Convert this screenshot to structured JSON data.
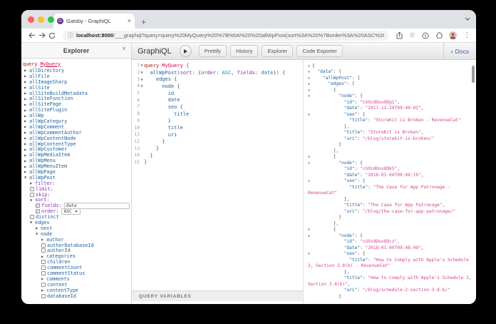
{
  "colors": {
    "traffic_red": "#ff5f57",
    "traffic_yellow": "#febc2e",
    "traffic_green": "#28c840",
    "field_blue": "#1f61a0",
    "arg_purple": "#8b2bb9",
    "keyword_red": "#b11a04",
    "def_pink": "#d2054e",
    "enum_cyan": "#0b7fc7",
    "string_pink": "#d64292",
    "docs_blue": "#3b5998"
  },
  "browser": {
    "tab_title": "Gatsby - GraphiQL",
    "tab_close": "×",
    "new_tab": "+",
    "favicon_letter": "G",
    "url_host": "localhost:8000",
    "url_path": "/___graphql?query=query%20MyQuery%20%7B%0A%20%20allWpPost(sort%3A%20%7Border%3A%20ASC%2C%20fields%3A%2...",
    "info_icon": "ⓘ",
    "star_icon": "☆",
    "menu_icon": "⋮"
  },
  "graphiql": {
    "logo": "GraphiQL",
    "buttons": [
      "Prettify",
      "History",
      "Explorer",
      "Code Exporter"
    ],
    "docs_chevron": "‹",
    "docs_label": "Docs",
    "variables_title": "QUERY VARIABLES"
  },
  "explorer": {
    "title": "Explorer",
    "close": "×",
    "query_keyword": "query",
    "query_name": "MyQuery",
    "items": [
      {
        "a": "r",
        "t": "allDirectory",
        "k": "f",
        "i": 0
      },
      {
        "a": "r",
        "t": "allFile",
        "k": "f",
        "i": 0
      },
      {
        "a": "r",
        "t": "allImageSharp",
        "k": "f",
        "i": 0
      },
      {
        "a": "r",
        "t": "allSite",
        "k": "f",
        "i": 0
      },
      {
        "a": "r",
        "t": "allSiteBuildMetadata",
        "k": "f",
        "i": 0
      },
      {
        "a": "r",
        "t": "allSiteFunction",
        "k": "f",
        "i": 0
      },
      {
        "a": "r",
        "t": "allSitePage",
        "k": "f",
        "i": 0
      },
      {
        "a": "r",
        "t": "allSitePlugin",
        "k": "f",
        "i": 0
      },
      {
        "a": "r",
        "t": "allWp",
        "k": "f",
        "i": 0
      },
      {
        "a": "r",
        "t": "allWpCategory",
        "k": "f",
        "i": 0
      },
      {
        "a": "r",
        "t": "allWpComment",
        "k": "f",
        "i": 0
      },
      {
        "a": "r",
        "t": "allWpCommentAuthor",
        "k": "f",
        "i": 0
      },
      {
        "a": "r",
        "t": "allWpContentNode",
        "k": "f",
        "i": 0
      },
      {
        "a": "r",
        "t": "allWpContentType",
        "k": "f",
        "i": 0
      },
      {
        "a": "r",
        "t": "allWpCustomer",
        "k": "f",
        "i": 0
      },
      {
        "a": "r",
        "t": "allWpMediaItem",
        "k": "f",
        "i": 0
      },
      {
        "a": "r",
        "t": "allWpMenu",
        "k": "f",
        "i": 0
      },
      {
        "a": "r",
        "t": "allWpMenuItem",
        "k": "f",
        "i": 0
      },
      {
        "a": "r",
        "t": "allWpPage",
        "k": "f",
        "i": 0
      },
      {
        "a": "d",
        "t": "allWpPost",
        "k": "f",
        "i": 0
      },
      {
        "a": "r",
        "t": "filter:",
        "k": "a",
        "i": 1
      },
      {
        "c": "u",
        "t": "limit:",
        "k": "a",
        "i": 1
      },
      {
        "c": "u",
        "t": "skip:",
        "k": "a",
        "i": 1
      },
      {
        "a": "d",
        "t": "sort:",
        "k": "a",
        "i": 1
      },
      {
        "c": "c",
        "t": "fields:",
        "k": "a",
        "i": 2,
        "ctl": {
          "type": "input",
          "value": "date"
        }
      },
      {
        "c": "c",
        "t": "order:",
        "k": "a",
        "i": 2,
        "ctl": {
          "type": "select",
          "value": "ASC"
        }
      },
      {
        "c": "u",
        "t": "distinct",
        "k": "f",
        "i": 1
      },
      {
        "a": "d",
        "t": "edges",
        "k": "f",
        "i": 1
      },
      {
        "a": "r",
        "t": "next",
        "k": "f",
        "i": 2
      },
      {
        "a": "d",
        "t": "node",
        "k": "f",
        "i": 2
      },
      {
        "a": "r",
        "t": "author",
        "k": "f",
        "i": 3
      },
      {
        "c": "u",
        "t": "authorDatabaseId",
        "k": "f",
        "i": 3
      },
      {
        "c": "u",
        "t": "authorId",
        "k": "f",
        "i": 3
      },
      {
        "a": "r",
        "t": "categories",
        "k": "f",
        "i": 3
      },
      {
        "c": "u",
        "t": "children",
        "k": "f",
        "i": 3
      },
      {
        "c": "u",
        "t": "commentCount",
        "k": "f",
        "i": 3
      },
      {
        "c": "u",
        "t": "commentStatus",
        "k": "f",
        "i": 3
      },
      {
        "a": "r",
        "t": "comments",
        "k": "f",
        "i": 3
      },
      {
        "c": "u",
        "t": "content",
        "k": "f",
        "i": 3
      },
      {
        "a": "r",
        "t": "contentType",
        "k": "f",
        "i": 3
      },
      {
        "c": "u",
        "t": "databaseId",
        "k": "f",
        "i": 3
      }
    ]
  },
  "editor": {
    "lines": [
      {
        "num": 1,
        "fold": true,
        "tokens": [
          [
            "kw",
            "query"
          ],
          [
            "pun",
            " "
          ],
          [
            "def",
            "MyQuery"
          ],
          [
            "pun",
            " {"
          ]
        ]
      },
      {
        "num": 2,
        "fold": true,
        "tokens": [
          [
            "pun",
            "  "
          ],
          [
            "prop",
            "allWpPost"
          ],
          [
            "pun",
            "("
          ],
          [
            "attr",
            "sort"
          ],
          [
            "pun",
            ": {"
          ],
          [
            "attr",
            "order"
          ],
          [
            "pun",
            ": "
          ],
          [
            "enum",
            "ASC"
          ],
          [
            "pun",
            ", "
          ],
          [
            "attr",
            "fields"
          ],
          [
            "pun",
            ": "
          ],
          [
            "enum",
            "date"
          ],
          [
            "pun",
            "}) {"
          ]
        ]
      },
      {
        "num": 3,
        "fold": true,
        "tokens": [
          [
            "pun",
            "    "
          ],
          [
            "prop",
            "edges"
          ],
          [
            "pun",
            " {"
          ]
        ]
      },
      {
        "num": 4,
        "fold": true,
        "tokens": [
          [
            "pun",
            "      "
          ],
          [
            "prop",
            "node"
          ],
          [
            "pun",
            " {"
          ]
        ]
      },
      {
        "num": 5,
        "fold": false,
        "tokens": [
          [
            "pun",
            "        "
          ],
          [
            "prop",
            "id"
          ]
        ]
      },
      {
        "num": 6,
        "fold": false,
        "tokens": [
          [
            "pun",
            "        "
          ],
          [
            "prop",
            "date"
          ]
        ]
      },
      {
        "num": 7,
        "fold": false,
        "tokens": [
          [
            "pun",
            "        "
          ],
          [
            "prop",
            "seo"
          ],
          [
            "pun",
            " {"
          ]
        ]
      },
      {
        "num": 8,
        "fold": false,
        "tokens": [
          [
            "pun",
            "          "
          ],
          [
            "prop",
            "title"
          ]
        ]
      },
      {
        "num": 9,
        "fold": false,
        "tokens": [
          [
            "pun",
            "        }"
          ]
        ]
      },
      {
        "num": 10,
        "fold": false,
        "tokens": [
          [
            "pun",
            "        "
          ],
          [
            "prop",
            "title"
          ]
        ]
      },
      {
        "num": 11,
        "fold": false,
        "tokens": [
          [
            "pun",
            "        "
          ],
          [
            "prop",
            "uri"
          ]
        ]
      },
      {
        "num": 12,
        "fold": false,
        "tokens": [
          [
            "pun",
            "      }"
          ]
        ]
      },
      {
        "num": 13,
        "fold": false,
        "tokens": [
          [
            "pun",
            "    }"
          ]
        ]
      },
      {
        "num": 14,
        "fold": false,
        "tokens": [
          [
            "pun",
            "  }"
          ]
        ]
      },
      {
        "num": 15,
        "fold": false,
        "tokens": [
          [
            "pun",
            "}"
          ]
        ]
      }
    ]
  },
  "results": {
    "lines": [
      {
        "fold": true,
        "tokens": [
          [
            "p",
            "{"
          ]
        ]
      },
      {
        "fold": true,
        "tokens": [
          [
            "p",
            "  "
          ],
          [
            "k",
            "\"data\""
          ],
          [
            "p",
            ": {"
          ]
        ]
      },
      {
        "fold": true,
        "tokens": [
          [
            "p",
            "    "
          ],
          [
            "k",
            "\"allWpPost\""
          ],
          [
            "p",
            ": {"
          ]
        ]
      },
      {
        "fold": true,
        "tokens": [
          [
            "p",
            "      "
          ],
          [
            "k",
            "\"edges\""
          ],
          [
            "p",
            ": ["
          ]
        ]
      },
      {
        "fold": true,
        "tokens": [
          [
            "p",
            "        {"
          ]
        ]
      },
      {
        "fold": true,
        "tokens": [
          [
            "p",
            "          "
          ],
          [
            "k",
            "\"node\""
          ],
          [
            "p",
            ": {"
          ]
        ]
      },
      {
        "tokens": [
          [
            "p",
            "            "
          ],
          [
            "k",
            "\"id\""
          ],
          [
            "p",
            ": "
          ],
          [
            "s",
            "\"cG9zdDoxODg1\""
          ],
          [
            "p",
            ","
          ]
        ]
      },
      {
        "tokens": [
          [
            "p",
            "            "
          ],
          [
            "k",
            "\"date\""
          ],
          [
            "p",
            ": "
          ],
          [
            "s",
            "\"2017-11-29T09:49:02\""
          ],
          [
            "p",
            ","
          ]
        ]
      },
      {
        "fold": true,
        "tokens": [
          [
            "p",
            "            "
          ],
          [
            "k",
            "\"seo\""
          ],
          [
            "p",
            ": {"
          ]
        ]
      },
      {
        "tokens": [
          [
            "p",
            "              "
          ],
          [
            "k",
            "\"title\""
          ],
          [
            "p",
            ": "
          ],
          [
            "s",
            "\"StoreKit is Broken - RevenueCat\""
          ]
        ]
      },
      {
        "tokens": [
          [
            "p",
            "            },"
          ]
        ]
      },
      {
        "tokens": [
          [
            "p",
            "            "
          ],
          [
            "k",
            "\"title\""
          ],
          [
            "p",
            ": "
          ],
          [
            "s",
            "\"StoreKit is Broken\""
          ],
          [
            "p",
            ","
          ]
        ]
      },
      {
        "tokens": [
          [
            "p",
            "            "
          ],
          [
            "k",
            "\"uri\""
          ],
          [
            "p",
            ": "
          ],
          [
            "s",
            "\"/blog/storekit-is-broken/\""
          ]
        ]
      },
      {
        "tokens": [
          [
            "p",
            "          }"
          ]
        ]
      },
      {
        "tokens": [
          [
            "p",
            "        },"
          ]
        ]
      },
      {
        "fold": true,
        "tokens": [
          [
            "p",
            "        {"
          ]
        ]
      },
      {
        "fold": true,
        "tokens": [
          [
            "p",
            "          "
          ],
          [
            "k",
            "\"node\""
          ],
          [
            "p",
            ": {"
          ]
        ]
      },
      {
        "tokens": [
          [
            "p",
            "            "
          ],
          [
            "k",
            "\"id\""
          ],
          [
            "p",
            ": "
          ],
          [
            "s",
            "\"cG9zdDoxODk5\""
          ],
          [
            "p",
            ","
          ]
        ]
      },
      {
        "tokens": [
          [
            "p",
            "            "
          ],
          [
            "k",
            "\"date\""
          ],
          [
            "p",
            ": "
          ],
          [
            "s",
            "\"2018-01-04T09:49:19\""
          ],
          [
            "p",
            ","
          ]
        ]
      },
      {
        "fold": true,
        "tokens": [
          [
            "p",
            "            "
          ],
          [
            "k",
            "\"seo\""
          ],
          [
            "p",
            ": {"
          ]
        ]
      },
      {
        "tokens": [
          [
            "p",
            "              "
          ],
          [
            "k",
            "\"title\""
          ],
          [
            "p",
            ": "
          ],
          [
            "s",
            "\"The Case for App Patronage -"
          ]
        ]
      },
      {
        "cont": true,
        "tokens": [
          [
            "s",
            "RevenueCat\""
          ]
        ]
      },
      {
        "tokens": [
          [
            "p",
            "            },"
          ]
        ]
      },
      {
        "tokens": [
          [
            "p",
            "            "
          ],
          [
            "k",
            "\"title\""
          ],
          [
            "p",
            ": "
          ],
          [
            "s",
            "\"The Case for App Patronage\""
          ],
          [
            "p",
            ","
          ]
        ]
      },
      {
        "tokens": [
          [
            "p",
            "            "
          ],
          [
            "k",
            "\"uri\""
          ],
          [
            "p",
            ": "
          ],
          [
            "s",
            "\"/blog/the-case-for-app-patronage/\""
          ]
        ]
      },
      {
        "tokens": [
          [
            "p",
            "          }"
          ]
        ]
      },
      {
        "tokens": [
          [
            "p",
            "        },"
          ]
        ]
      },
      {
        "fold": true,
        "tokens": [
          [
            "p",
            "        {"
          ]
        ]
      },
      {
        "fold": true,
        "tokens": [
          [
            "p",
            "          "
          ],
          [
            "k",
            "\"node\""
          ],
          [
            "p",
            ": {"
          ]
        ]
      },
      {
        "tokens": [
          [
            "p",
            "            "
          ],
          [
            "k",
            "\"id\""
          ],
          [
            "p",
            ": "
          ],
          [
            "s",
            "\"cG9zdDoxODcz\""
          ],
          [
            "p",
            ","
          ]
        ]
      },
      {
        "tokens": [
          [
            "p",
            "            "
          ],
          [
            "k",
            "\"date\""
          ],
          [
            "p",
            ": "
          ],
          [
            "s",
            "\"2018-01-09T09:48:49\""
          ],
          [
            "p",
            ","
          ]
        ]
      },
      {
        "fold": true,
        "tokens": [
          [
            "p",
            "            "
          ],
          [
            "k",
            "\"seo\""
          ],
          [
            "p",
            ": {"
          ]
        ]
      },
      {
        "tokens": [
          [
            "p",
            "              "
          ],
          [
            "k",
            "\"title\""
          ],
          [
            "p",
            ": "
          ],
          [
            "s",
            "\"How to Comply with Apple's Schedule"
          ]
        ]
      },
      {
        "cont": true,
        "tokens": [
          [
            "s",
            "2, Section 3.8(b) - RevenueCat\""
          ]
        ]
      },
      {
        "tokens": [
          [
            "p",
            "            },"
          ]
        ]
      },
      {
        "tokens": [
          [
            "p",
            "            "
          ],
          [
            "k",
            "\"title\""
          ],
          [
            "p",
            ": "
          ],
          [
            "s",
            "\"How to Comply with Apple's Schedule 2,"
          ]
        ]
      },
      {
        "cont": true,
        "tokens": [
          [
            "s",
            "Section 3.8(b)\""
          ],
          [
            "p",
            ","
          ]
        ]
      },
      {
        "tokens": [
          [
            "p",
            "            "
          ],
          [
            "k",
            "\"uri\""
          ],
          [
            "p",
            ": "
          ],
          [
            "s",
            "\"/blog/schedule-2-section-3-8-b/\""
          ]
        ]
      },
      {
        "tokens": [
          [
            "p",
            "          }"
          ]
        ]
      }
    ]
  }
}
